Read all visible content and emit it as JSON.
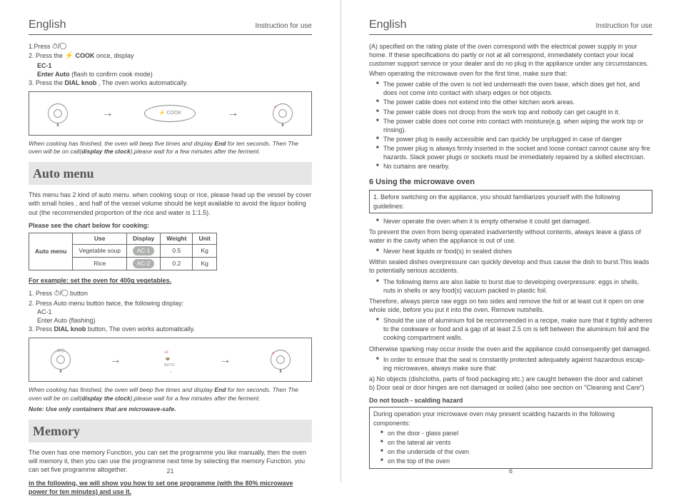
{
  "left": {
    "header": {
      "lang": "English",
      "instr": "Instruction for use"
    },
    "steps1": {
      "s1": "1.Press ",
      "s1_icon_hint": "⏱/◯",
      "s2a": "2. Press the ",
      "s2_cook": "COOK",
      "s2b": " once, display",
      "ec1": "EC-1",
      "enter_auto": "Enter  Auto",
      "enter_auto_tail": "  (flash to confirm cook mode)",
      "s3a": "3. Press the",
      "s3b": "DIAL knob",
      "s3c": ", The oven works automatically."
    },
    "illus1_cook": "COOK",
    "after_cook": "When cooking has finished, the oven will beep five times and display End for ten seconds. Then The oven will be on call(display the clock),please wait for a few minutes after the ferment.",
    "auto_title": "Auto  menu",
    "auto_intro": "This menu has 2 kind of auto menu. when cooking soup or rice, please head up the vessel by  cover with  small holes , and half of the vessel volume should be kept  available to avoid the liquor boiling out (the recommended proportion of the rice and water is 1:1.5).",
    "chart_label": "Please see the chart below for cooking:",
    "table": {
      "headers": [
        "Use",
        "Display",
        "Weight",
        "Unit"
      ],
      "rowhdr": "Auto menu",
      "rows": [
        {
          "use": "Vegetable soup",
          "display": "AC-1",
          "weight": "0.5",
          "unit": "Kg"
        },
        {
          "use": "Rice",
          "display": "AC-2",
          "weight": "0.2",
          "unit": "Kg"
        }
      ]
    },
    "example": "For example: set the oven for 400g vegetables.",
    "steps2": {
      "s1": "1. Press ",
      "s1_icon_hint": "⏱/◯",
      "s1_tail": " button",
      "s2": "2. Press Auto menu button twice, the following  display:",
      "ac1": "AC-1",
      "enter_auto": "Enter  Auto  (flashing)",
      "s3a": "3. Press ",
      "s3b": "DIAL knob",
      "s3c": " button, The oven works automatically."
    },
    "illus2_auto": "AUTO",
    "after_auto": "When cooking has finished, the oven will beep five times and display End for ten seconds. Then The oven will be on call(display the clock),please wait for a few minutes after the ferment.",
    "note": "Note: Use only containers that are microwave-safe.",
    "memory_title": "Memory",
    "memory_body": "The oven has one memory Function, you can set the programme you like manually, then the oven will memory it, then you can use the programme next time by selecting the memory Function. you can set five programme altogether.",
    "memory_lead": "in the following, we will show you how to set one programme (with the 80% microwave power for ten minutes) and use it.",
    "pagenum": "21"
  },
  "right": {
    "header": {
      "lang": "English",
      "instr": "Instruction for use"
    },
    "p1": "(A) specified on the rating plate of the oven correspond with the electrical power supply in your home. If these specifications do partly or not at all correspond, immediately contact your local customer support service or your dealer and do no plug in the appliance under any circumstances.",
    "p2": "When operating the microwave oven for the first time, make sure that:",
    "bl1": [
      "The power cable of the oven is not led underneath the oven base, which does get hot, and does not come into contact with  sharp edges or hot objects.",
      "The power cable  does not extend into the other  kitchen work areas.",
      "The power cable does  not droop from the work top  and nobody can get caught in it.",
      "The power cable does not come into contact with moisture(e.g. when wiping the work top or rinsing).",
      "The power plug  is easily accessible and can quickly  be unplugged in case  of danger",
      "The power plug is always firmly inserted in the socket and loose contact cannot cause any fire hazards. Slack power plugs  or sockets must be immediately  repaired by a skilled  electrician.",
      "No curtains are  nearby."
    ],
    "h6": "6 Using the microwave oven",
    "box1": "1. Before switching on the appliance, you should familiarizes yourself with the following guidelines:",
    "bl2": [
      "Never operate the oven when it is empty otherwise it could get damaged."
    ],
    "p3": "To prevent the oven from being  operated inadvertently without contents, always leave a glass of water in the cavity  when the appliance is out of use.",
    "bl3": [
      "Never heat liquids or food(s) in sealed dishes"
    ],
    "p4": "Within sealed dishes overpressure can quickly develop and thus cause the dish to burst.This leads to potentially serious accidents.",
    "bl4": [
      "The following items are also liable to burst due to developing overpressure: eggs in shells, nuts in shells  or any food(s) vacuum packed in plastic foil."
    ],
    "p5": "Therefore, always pierce raw eggs on two sides and remove the foil or at least cut it  open on one whole side, before you  put it into the oven.  Remove nutshells.",
    "bl5": [
      "Should the use of aluminium foil be recommended  in a recipe, make sure that it tightly adheres to the cookware or  food and  a gap of  at least 2.5 cm is left between  the aluminium foil  and the cooking compartment walls."
    ],
    "p6": "Otherwise sparking may occur inside the oven and the appliance could consequently get damaged.",
    "bl6": [
      "In order to ensure that the seal is constantly protected adequately against hazardous escap- ing microwaves,   always make sure that:"
    ],
    "pa": "a)  No objects  (dishcloths, parts of food  packaging etc.) are caught between the door and cabinet",
    "pb": "b)  Door seal or door hinges    are not damaged or  soiled (also see section on \"Cleaning and Care\")",
    "donot": "Do not touch - scalding hazard",
    "box2_lead": "During operation your microwave oven may present scalding  hazards in the following components:",
    "box2_items": [
      "on the door - glass panel",
      "on the lateral air vents",
      "on the underside  of the oven",
      "on the top  of the oven"
    ],
    "pagenum": "6"
  }
}
